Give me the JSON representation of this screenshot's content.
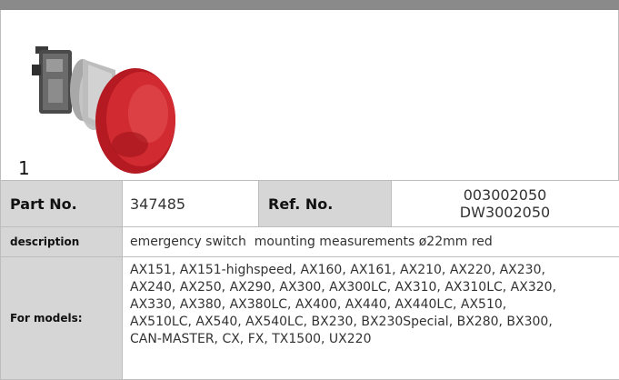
{
  "figure_number": "1",
  "icons": {
    "product_photo": "emergency-stop-button-photo"
  },
  "colors": {
    "header_bar": "#8a8a8a",
    "label_bg": "#d6d6d6",
    "button_red": "#c8202a"
  },
  "table": {
    "part_no_label": "Part No.",
    "part_no_value": "347485",
    "ref_no_label": "Ref. No.",
    "ref_no_values": [
      "003002050",
      "DW3002050"
    ],
    "description_label": "description",
    "description_value": "emergency switch  mounting measurements ø22mm red",
    "models_label": "For models:",
    "models_lines": [
      "AX151, AX151-highspeed, AX160, AX161, AX210, AX220, AX230,",
      "AX240, AX250, AX290, AX300, AX300LC, AX310, AX310LC, AX320,",
      "AX330, AX380, AX380LC, AX400, AX440, AX440LC, AX510,",
      "AX510LC, AX540, AX540LC, BX230, BX230Special, BX280, BX300,",
      "CAN-MASTER, CX, FX, TX1500, UX220"
    ]
  }
}
